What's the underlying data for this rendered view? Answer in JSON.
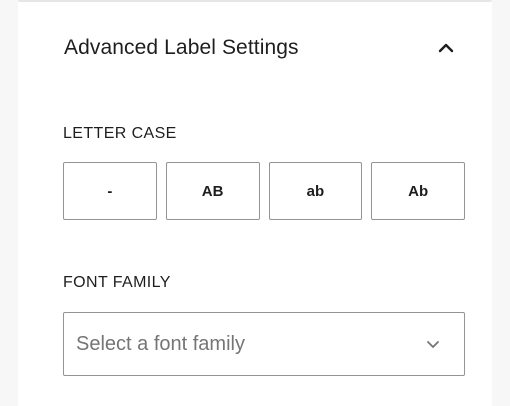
{
  "panel": {
    "section_title": "Advanced Label Settings",
    "toggle_icon": "chevron-up-icon"
  },
  "letter_case": {
    "label": "LETTER CASE",
    "options": [
      {
        "label": "-"
      },
      {
        "label": "AB"
      },
      {
        "label": "ab"
      },
      {
        "label": "Ab"
      }
    ]
  },
  "font_family": {
    "label": "FONT FAMILY",
    "placeholder": "Select a font family",
    "dropdown_icon": "chevron-down-icon"
  },
  "colors": {
    "text": "#1e1e1e",
    "border": "#949494",
    "placeholder": "#757575",
    "background": "#ffffff",
    "gutter": "#f7f7f7"
  }
}
